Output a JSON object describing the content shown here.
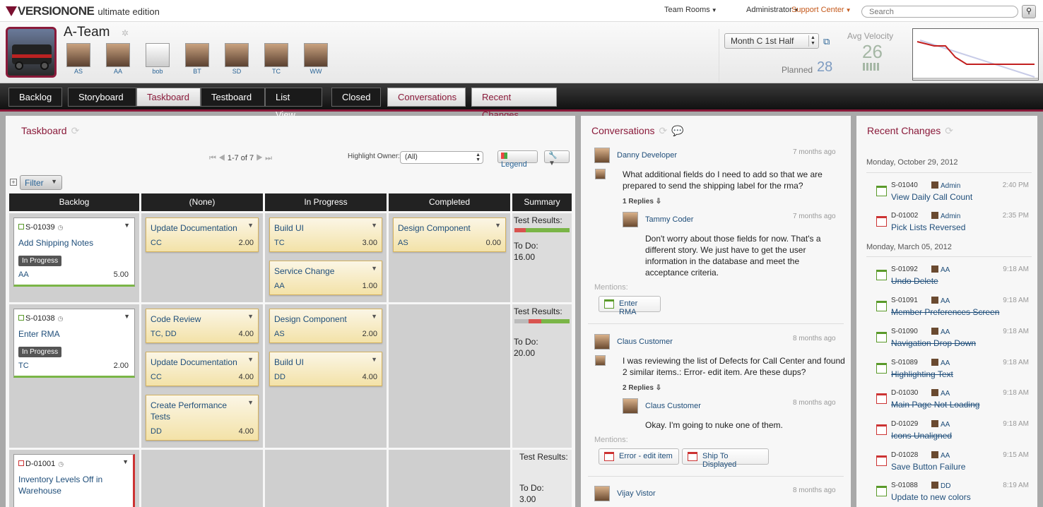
{
  "top": {
    "brand": "VERSIONONE",
    "edition": "ultimate edition",
    "nav": [
      "Team Rooms",
      "Administrator",
      "Support Center"
    ],
    "search_placeholder": "Search"
  },
  "team": {
    "name": "A-Team",
    "members": [
      "AS",
      "AA",
      "bob",
      "BT",
      "SD",
      "TC",
      "WW"
    ],
    "iteration": "Month C 1st Half",
    "planned_label": "Planned",
    "planned_value": "28",
    "velocity_label": "Avg Velocity",
    "velocity_value": "26"
  },
  "tabs": [
    "Backlog",
    "Storyboard",
    "Taskboard",
    "Testboard",
    "List View",
    "Closed",
    "Conversations",
    "Recent Changes"
  ],
  "taskboard": {
    "title": "Taskboard",
    "pager": "1-7 of 7",
    "highlight_label": "Highlight Owner:",
    "highlight_value": "(All)",
    "legend_label": "Legend",
    "filter_label": "Filter",
    "columns": [
      "Backlog",
      "(None)",
      "In Progress",
      "Completed",
      "Summary"
    ],
    "rows": [
      {
        "story": {
          "id": "S-01039",
          "title": "Add Shipping Notes",
          "status": "In Progress",
          "owner": "AA",
          "estimate": "5.00"
        },
        "none": [
          {
            "title": "Update Documentation",
            "owner": "CC",
            "estimate": "2.00"
          }
        ],
        "in_progress": [
          {
            "title": "Build UI",
            "owner": "TC",
            "estimate": "3.00"
          },
          {
            "title": "Service Change",
            "owner": "AA",
            "estimate": "1.00"
          }
        ],
        "completed": [
          {
            "title": "Design Component",
            "owner": "AS",
            "estimate": "0.00"
          }
        ],
        "summary": {
          "tests_label": "Test Results:",
          "todo_label": "To Do:",
          "todo": "16.00"
        }
      },
      {
        "story": {
          "id": "S-01038",
          "title": "Enter RMA",
          "status": "In Progress",
          "owner": "TC",
          "estimate": "2.00"
        },
        "none": [
          {
            "title": "Code Review",
            "owner": "TC, DD",
            "estimate": "4.00"
          },
          {
            "title": "Update Documentation",
            "owner": "CC",
            "estimate": "4.00"
          },
          {
            "title": "Create Performance Tests",
            "owner": "DD",
            "estimate": "4.00"
          }
        ],
        "in_progress": [
          {
            "title": "Design Component",
            "owner": "AS",
            "estimate": "2.00"
          },
          {
            "title": "Build UI",
            "owner": "DD",
            "estimate": "4.00"
          }
        ],
        "completed": [],
        "summary": {
          "tests_label": "Test Results:",
          "todo_label": "To Do:",
          "todo": "20.00"
        }
      },
      {
        "story": {
          "id": "D-01001",
          "title": "Inventory Levels Off in Warehouse"
        },
        "summary": {
          "tests_label": "Test Results:",
          "todo_label": "To Do:",
          "todo": "3.00"
        }
      }
    ]
  },
  "conversations": {
    "title": "Conversations",
    "threads": [
      {
        "author": "Danny Developer",
        "time": "7 months ago",
        "text": "What additional fields do I need to add so that we are prepared to send the shipping label for the rma?",
        "replies_label": "1 Replies",
        "replies": [
          {
            "author": "Tammy Coder",
            "time": "7 months ago",
            "text": "Don't worry about those fields for now.  That's a different story.  We just have to get the user information in the database and meet the acceptance criteria."
          }
        ],
        "mentions_label": "Mentions:",
        "mentions": [
          "Enter RMA"
        ]
      },
      {
        "author": "Claus Customer",
        "time": "8 months ago",
        "text": "I was reviewing the list of Defects for Call Center and found 2 similar items.: Error- edit item.  Are these dups?",
        "replies_label": "2 Replies",
        "replies": [
          {
            "author": "Claus Customer",
            "time": "8 months ago",
            "text": "Okay.  I'm going to nuke one of them."
          }
        ],
        "mentions_label": "Mentions:",
        "mentions": [
          "Error - edit item",
          "Ship To Displayed"
        ]
      },
      {
        "author": "Vijay Vistor",
        "time": "8 months ago"
      }
    ]
  },
  "recent": {
    "title": "Recent Changes",
    "dates": [
      "Monday, October 29, 2012",
      "Monday, March 05, 2012"
    ],
    "items": [
      {
        "id": "S-01040",
        "who": "Admin",
        "time": "2:40 PM",
        "title": "View Daily Call Count"
      },
      {
        "id": "D-01002",
        "who": "Admin",
        "time": "2:35 PM",
        "title": "Pick Lists Reversed"
      },
      {
        "id": "S-01092",
        "who": "AA",
        "time": "9:18 AM",
        "title": "Undo Delete"
      },
      {
        "id": "S-01091",
        "who": "AA",
        "time": "9:18 AM",
        "title": "Member Preferences Screen"
      },
      {
        "id": "S-01090",
        "who": "AA",
        "time": "9:18 AM",
        "title": "Navigation Drop Down"
      },
      {
        "id": "S-01089",
        "who": "AA",
        "time": "9:18 AM",
        "title": "Highlighting Text"
      },
      {
        "id": "D-01030",
        "who": "AA",
        "time": "9:18 AM",
        "title": "Main Page Not Loading"
      },
      {
        "id": "D-01029",
        "who": "AA",
        "time": "9:18 AM",
        "title": "Icons Unaligned"
      },
      {
        "id": "D-01028",
        "who": "AA",
        "time": "9:15 AM",
        "title": "Save Button Failure"
      },
      {
        "id": "S-01088",
        "who": "DD",
        "time": "8:19 AM",
        "title": "Update to new colors"
      }
    ]
  },
  "colors": {
    "brand": "#8a1a3a",
    "link": "#1f4e7a",
    "story_green": "#7ab547",
    "defect_red": "#cc3333"
  }
}
